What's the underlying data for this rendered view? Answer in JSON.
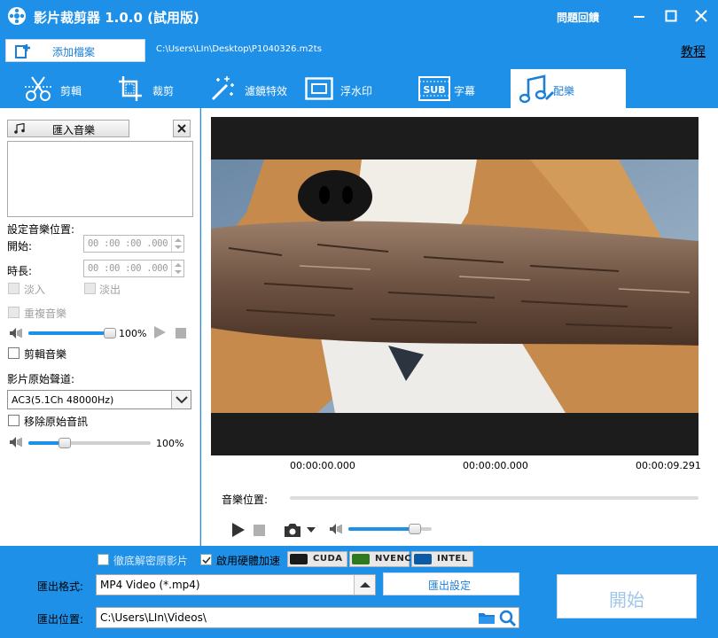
{
  "window": {
    "title": "影片裁剪器 1.0.0 (試用版)",
    "feedback_label": "問題回饋"
  },
  "toolbar": {
    "add_file_label": "添加檔案",
    "file_path": "C:\\Users\\LIn\\Desktop\\P1040326.m2ts",
    "tutorial_label": "教程"
  },
  "tabs": [
    {
      "label": "剪輯",
      "icon": "scissors-icon"
    },
    {
      "label": "裁剪",
      "icon": "crop-icon"
    },
    {
      "label": "濾鏡特效",
      "icon": "magic-wand-icon"
    },
    {
      "label": "浮水印",
      "icon": "watermark-icon"
    },
    {
      "label": "字幕",
      "icon": "subtitle-icon"
    },
    {
      "label": "配樂",
      "icon": "music-note-icon",
      "active": true
    }
  ],
  "music_panel": {
    "import_label": "匯入音樂",
    "set_position_label": "設定音樂位置:",
    "start_label": "開始:",
    "start_value": "00 :00 :00 .000",
    "duration_label": "時長:",
    "duration_value": "00 :00 :00 .000",
    "fade_in_label": "淡入",
    "fade_out_label": "淡出",
    "repeat_label": "重複音樂",
    "music_volume_percent": 100,
    "music_volume_label": "100%",
    "trim_music_label": "剪輯音樂",
    "original_track_label": "影片原始聲道:",
    "original_track_value": "AC3(5.1Ch 48000Hz)",
    "remove_original_label": "移除原始音訊",
    "original_volume_percent": 30,
    "original_volume_label": "100%"
  },
  "player": {
    "time_start": "00:00:00.000",
    "time_current": "00:00:00.000",
    "time_end": "00:00:09.291",
    "music_position_label": "音樂位置:",
    "volume_percent": 80
  },
  "bottom": {
    "deep_decode_label": "徹底解密原影片",
    "deep_decode_checked": false,
    "hw_accel_label": "啟用硬體加速",
    "hw_accel_checked": true,
    "gpu_badges": [
      "CUDA",
      "NVENC",
      "INTEL"
    ],
    "format_label": "匯出格式:",
    "format_value": "MP4 Video (*.mp4)",
    "settings_label": "匯出設定",
    "location_label": "匯出位置:",
    "location_value": "C:\\Users\\LIn\\Videos\\",
    "start_label": "開始"
  },
  "colors": {
    "accent": "#1e90e8",
    "accent_text": "#1e7fd6"
  }
}
